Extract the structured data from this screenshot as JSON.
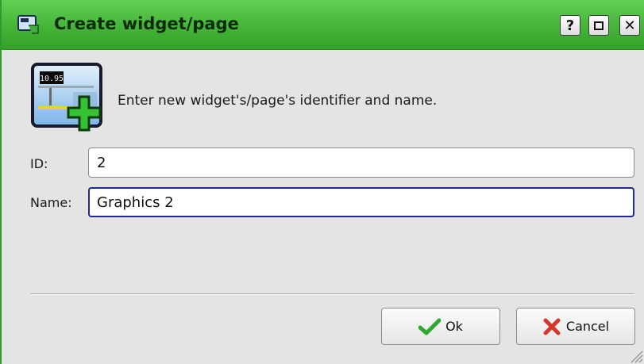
{
  "window": {
    "title": "Create widget/page",
    "help_glyph": "?",
    "close_glyph": "✕"
  },
  "dialog": {
    "prompt": "Enter new widget's/page's identifier and name.",
    "icon_value": "10.95",
    "fields": {
      "id_label": "ID:",
      "id_value": "2",
      "name_label": "Name:",
      "name_value": "Graphics 2"
    },
    "buttons": {
      "ok_label": "Ok",
      "cancel_label": "Cancel"
    }
  },
  "colors": {
    "titlebar_green": "#47b63a",
    "focus_border": "#1f2a8c",
    "ok_check": "#2ea82e",
    "cancel_x": "#d4382c"
  },
  "icons": [
    "app-window-icon",
    "help-icon",
    "maximize-icon",
    "close-icon",
    "widget-add-icon",
    "checkmark-icon",
    "cancel-x-icon",
    "resize-grip-icon"
  ]
}
